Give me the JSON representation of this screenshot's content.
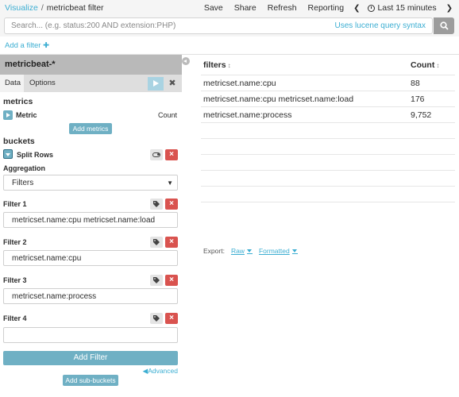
{
  "breadcrumb": {
    "root": "Visualize",
    "separator": "/",
    "current": "metricbeat filter"
  },
  "topmenu": {
    "save": "Save",
    "share": "Share",
    "refresh": "Refresh",
    "reporting": "Reporting",
    "time": "Last 15 minutes"
  },
  "search": {
    "placeholder": "Search... (e.g. status:200 AND extension:PHP)",
    "lucene": "Uses lucene query syntax"
  },
  "add_filter_link": "Add a filter",
  "sidebar": {
    "index": "metricbeat-*",
    "tabs": [
      "Data",
      "Options"
    ],
    "metrics_title": "metrics",
    "metric": {
      "label": "Metric",
      "value": "Count"
    },
    "add_metrics": "Add metrics",
    "buckets_title": "buckets",
    "split_rows": "Split Rows",
    "aggregation_label": "Aggregation",
    "aggregation_value": "Filters",
    "filters": [
      {
        "label": "Filter 1",
        "value": "metricset.name:cpu metricset.name:load"
      },
      {
        "label": "Filter 2",
        "value": "metricset.name:cpu"
      },
      {
        "label": "Filter 3",
        "value": "metricset.name:process"
      },
      {
        "label": "Filter 4",
        "value": ""
      }
    ],
    "add_filter": "Add Filter",
    "advanced": "Advanced",
    "add_subbuckets": "Add sub-buckets"
  },
  "table": {
    "headers": [
      "filters",
      "Count"
    ],
    "rows": [
      {
        "filter": "metricset.name:cpu",
        "count": "88"
      },
      {
        "filter": "metricset.name:cpu metricset.name:load",
        "count": "176"
      },
      {
        "filter": "metricset.name:process",
        "count": "9,752"
      }
    ]
  },
  "export": {
    "label": "Export:",
    "raw": "Raw",
    "formatted": "Formatted"
  },
  "colors": {
    "accent": "#3caed2",
    "button": "#6fb0c4",
    "danger": "#d9534f"
  }
}
